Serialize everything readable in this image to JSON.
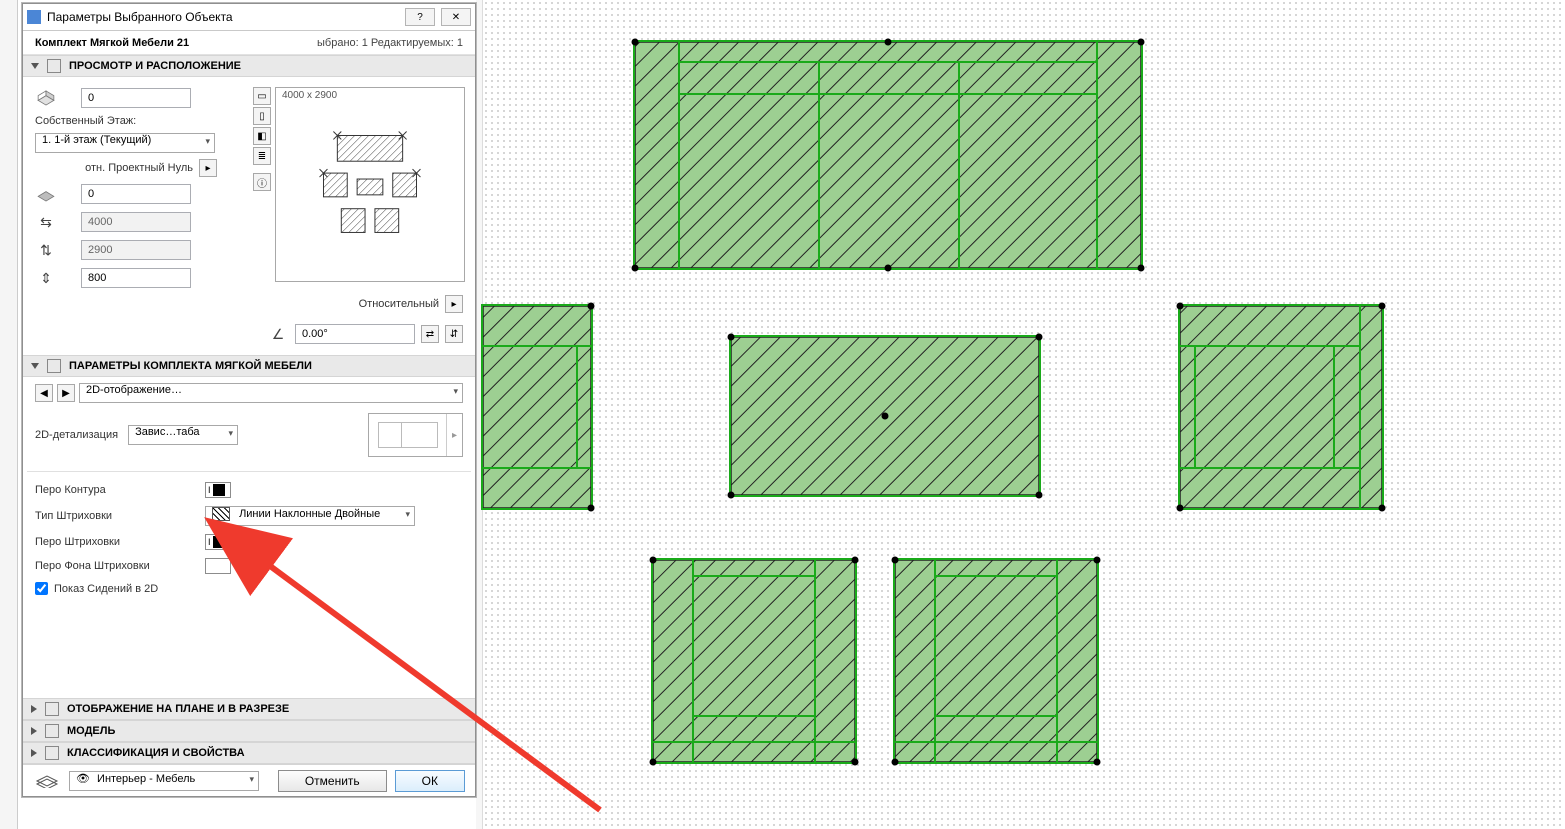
{
  "dialog": {
    "title": "Параметры Выбранного Объекта",
    "object_name": "Комплект Мягкой Мебели 21",
    "selection_summary": "ыбрано: 1 Редактируемых: 1",
    "sections": {
      "preview": {
        "label": "ПРОСМОТР И РАСПОЛОЖЕНИЕ"
      },
      "params": {
        "label": "ПАРАМЕТРЫ КОМПЛЕКТА МЯГКОЙ МЕБЕЛИ"
      },
      "display_plan": {
        "label": "ОТОБРАЖЕНИЕ НА ПЛАНЕ И В РАЗРЕЗЕ"
      },
      "model": {
        "label": "МОДЕЛЬ"
      },
      "classif": {
        "label": "КЛАССИФИКАЦИЯ И СВОЙСТВА"
      }
    },
    "placement": {
      "z_top": "0",
      "own_story_label": "Собственный Этаж:",
      "own_story_value": "1. 1-й этаж (Текущий)",
      "ref_level_label": "отн. Проектный Нуль",
      "z_bottom": "0",
      "dim_x": "4000",
      "dim_y": "2900",
      "dim_z": "800",
      "preview_size": "4000 x 2900",
      "angle_label": "Относительный",
      "angle_value": "0.00°"
    },
    "nav": {
      "page_dropdown": "2D-отображение…",
      "detail_label": "2D-детализация",
      "detail_value": "Завис…таба"
    },
    "pens": {
      "contour_label": "Перо Контура",
      "hatch_type_label": "Тип Штриховки",
      "hatch_type_value": "Линии Наклонные Двойные",
      "hatch_pen_label": "Перо Штриховки",
      "hatch_bg_label": "Перо Фона Штриховки",
      "show_seats_label": "Показ Сидений в 2D"
    },
    "footer": {
      "layer_value": "Интерьер - Мебель",
      "cancel": "Отменить",
      "ok": "ОК"
    }
  }
}
